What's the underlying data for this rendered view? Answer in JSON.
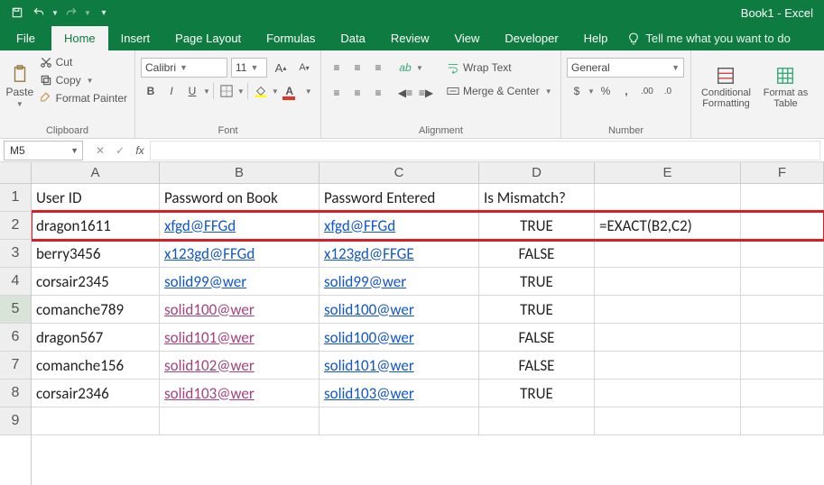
{
  "app": {
    "title": "Book1 - Excel"
  },
  "tabs": {
    "file": "File",
    "home": "Home",
    "insert": "Insert",
    "pagelayout": "Page Layout",
    "formulas": "Formulas",
    "data": "Data",
    "review": "Review",
    "view": "View",
    "developer": "Developer",
    "help": "Help",
    "tellme": "Tell me what you want to do"
  },
  "ribbon": {
    "clipboard": {
      "label": "Clipboard",
      "paste": "Paste",
      "cut": "Cut",
      "copy": "Copy",
      "formatpainter": "Format Painter"
    },
    "font": {
      "label": "Font",
      "name": "Calibri",
      "size": "11",
      "bold": "B",
      "italic": "I",
      "underline": "U"
    },
    "alignment": {
      "label": "Alignment",
      "wrap": "Wrap Text",
      "merge": "Merge & Center"
    },
    "number": {
      "label": "Number",
      "format": "General"
    },
    "styles": {
      "cond": "Conditional Formatting",
      "table": "Format as Table"
    }
  },
  "namebox": "M5",
  "columns": [
    "A",
    "B",
    "C",
    "D",
    "E",
    "F"
  ],
  "rows": [
    "1",
    "2",
    "3",
    "4",
    "5",
    "6",
    "7",
    "8",
    "9"
  ],
  "headers": {
    "A": "User ID",
    "B": "Password on Book",
    "C": "Password Entered",
    "D": "Is Mismatch?"
  },
  "data": [
    {
      "A": "dragon1611",
      "B": "xfgd@FFGd",
      "C": "xfgd@FFGd",
      "D": "TRUE",
      "E": "=EXACT(B2,C2)",
      "bstyle": "link",
      "cstyle": "link",
      "hl": true
    },
    {
      "A": "berry3456",
      "B": "x123gd@FFGd",
      "C": "x123gd@FFGE",
      "D": "FALSE",
      "bstyle": "link",
      "cstyle": "link"
    },
    {
      "A": "corsair2345",
      "B": "solid99@wer",
      "C": "solid99@wer",
      "D": "TRUE",
      "bstyle": "link",
      "cstyle": "link"
    },
    {
      "A": "comanche789",
      "B": "solid100@wer",
      "C": "solid100@wer",
      "D": "TRUE",
      "bstyle": "visited",
      "cstyle": "link"
    },
    {
      "A": "dragon567",
      "B": "solid101@wer",
      "C": "solid100@wer",
      "D": "FALSE",
      "bstyle": "visited",
      "cstyle": "link"
    },
    {
      "A": "comanche156",
      "B": "solid102@wer",
      "C": "solid101@wer",
      "D": "FALSE",
      "bstyle": "visited",
      "cstyle": "link"
    },
    {
      "A": "corsair2346",
      "B": "solid103@wer",
      "C": "solid103@wer",
      "D": "TRUE",
      "bstyle": "visited",
      "cstyle": "link"
    }
  ]
}
